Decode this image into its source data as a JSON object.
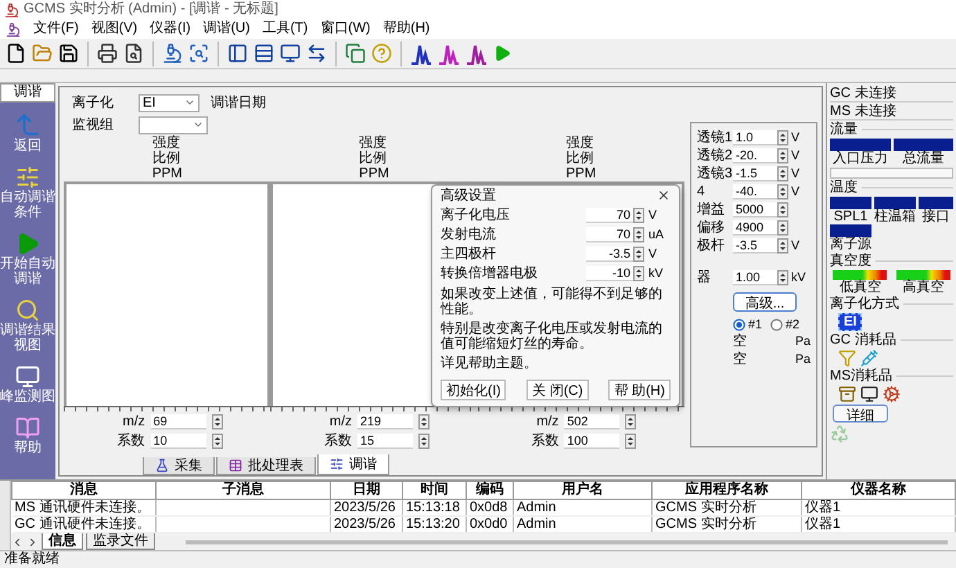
{
  "window": {
    "title": "GCMS 实时分析 (Admin) - [调谐 - 无标题]"
  },
  "menu": [
    "文件(F)",
    "视图(V)",
    "仪器(I)",
    "调谐(U)",
    "工具(T)",
    "窗口(W)",
    "帮助(H)"
  ],
  "sidebar": {
    "title": "调谐",
    "items": [
      {
        "label": "返回"
      },
      {
        "label": "自动调谐条件"
      },
      {
        "label": "开始自动调谐"
      },
      {
        "label": "调谐结果视图"
      },
      {
        "label": "峰监测图"
      },
      {
        "label": "帮助"
      }
    ]
  },
  "tuning": {
    "ionization": {
      "label": "离子化",
      "value": "EI"
    },
    "tune_date": {
      "label": "调谐日期"
    },
    "monitor_group": {
      "label": "监视组"
    }
  },
  "charts": [
    {
      "axis_labels": [
        "强度",
        "比例",
        "PPM"
      ],
      "mz_label": "m/z",
      "mz": "69",
      "coef_label": "系数",
      "coef": "10"
    },
    {
      "axis_labels": [
        "强度",
        "比例",
        "PPM"
      ],
      "mz_label": "m/z",
      "mz": "219",
      "coef_label": "系数",
      "coef": "15"
    },
    {
      "axis_labels": [
        "强度",
        "比例",
        "PPM"
      ],
      "mz_label": "m/z",
      "mz": "502",
      "coef_label": "系数",
      "coef": "100"
    }
  ],
  "parameters": [
    {
      "label": "透镜1",
      "value": "1.0",
      "unit": "V"
    },
    {
      "label": "透镜2",
      "value": "-20.",
      "unit": "V"
    },
    {
      "label": "透镜3",
      "value": "-1.5",
      "unit": "V"
    },
    {
      "label": "4",
      "value": "-40.",
      "unit": "V"
    },
    {
      "label": "增益",
      "value": "5000"
    },
    {
      "label": "偏移",
      "value": "4900"
    },
    {
      "label": "极杆",
      "value": "-3.5",
      "unit": "V"
    },
    {
      "label": "器",
      "value": "1.00",
      "unit": "kV"
    }
  ],
  "advanced_button": "高级...",
  "detectors": [
    {
      "label": "#1",
      "selected": true
    },
    {
      "label": "#2",
      "selected": false
    }
  ],
  "vacuum_readings": [
    {
      "label": "空",
      "unit": "Pa"
    },
    {
      "label": "空",
      "unit": "Pa"
    }
  ],
  "bottom_tabs": [
    {
      "label": "采集",
      "selected": false
    },
    {
      "label": "批处理表",
      "selected": false
    },
    {
      "label": "调谐",
      "selected": true
    }
  ],
  "dialog": {
    "title": "高级设置",
    "rows": [
      {
        "label": "离子化电压",
        "value": "70",
        "unit": "V"
      },
      {
        "label": "发射电流",
        "value": "70",
        "unit": "uA"
      },
      {
        "label": "主四极杆",
        "value": "-3.5",
        "unit": "V"
      },
      {
        "label": "转换倍增器电极",
        "value": "-10",
        "unit": "kV"
      }
    ],
    "notes": [
      "如果改变上述值，可能得不到足够的性能。",
      "特别是改变离子化电压或发射电流的值可能缩短灯丝的寿命。",
      "详见帮助主题。"
    ],
    "buttons": [
      "初始化(I)",
      "关 闭(C)",
      "帮 助(H)"
    ]
  },
  "status_panel": {
    "connections": [
      {
        "label": "GC",
        "status": "未连接"
      },
      {
        "label": "MS",
        "status": "未连接"
      }
    ],
    "flow": {
      "title": "流量",
      "items": [
        "入口压力",
        "总流量"
      ]
    },
    "temperature": {
      "title": "温度",
      "items": [
        "SPL1",
        "柱温箱",
        "接口",
        "离子源"
      ]
    },
    "vacuum": {
      "title": "真空度",
      "items": [
        "低真空",
        "高真空"
      ]
    },
    "ionization": {
      "title": "离子化方式",
      "value": "EI"
    },
    "gc_consumables": {
      "title": "GC 消耗品"
    },
    "ms_consumables": {
      "title": "MS消耗品"
    },
    "detail_button": "详细"
  },
  "log": {
    "columns": [
      "消息",
      "子消息",
      "日期",
      "时间",
      "编码",
      "用户名",
      "应用程序名称",
      "仪器名称"
    ],
    "rows": [
      [
        "MS 通讯硬件未连接。",
        "",
        "2023/5/26",
        "15:13:18",
        "0x0d8",
        "Admin",
        "GCMS 实时分析",
        "仪器1"
      ],
      [
        "GC 通讯硬件未连接。",
        "",
        "2023/5/26",
        "15:13:20",
        "0x0d0",
        "Admin",
        "GCMS 实时分析",
        "仪器1"
      ]
    ]
  },
  "log_tabs": [
    {
      "label": "信息",
      "selected": true
    },
    {
      "label": "监录文件",
      "selected": false
    }
  ],
  "status_bar": "准备就绪"
}
